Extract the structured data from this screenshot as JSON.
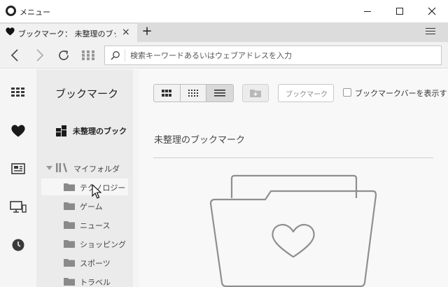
{
  "window": {
    "title": "メニュー"
  },
  "tab": {
    "label": "ブックマーク： 未整理のブックマーク",
    "close": "×",
    "new_tab": "+"
  },
  "address_bar": {
    "placeholder": "検索キーワードあるいはウェブアドレスを入力"
  },
  "sidebar_icons": [
    "speed-dial-icon",
    "heart-icon",
    "news-icon",
    "devices-icon",
    "history-icon"
  ],
  "panel": {
    "title": "ブックマーク",
    "unsorted_label": "未整理のブックマーク",
    "my_folder_label": "マイフォルダ",
    "folders": [
      "テクノロジー",
      "ゲーム",
      "ニュース",
      "ショッピング",
      "スポーツ",
      "トラベル"
    ]
  },
  "main": {
    "search_placeholder": "ブックマーク",
    "show_bar_label": "ブックマークバーを表示する",
    "show_bar_checked": false,
    "section_title": "未整理のブックマーク"
  },
  "colors": {
    "sidebar_bg": "#f5f5f5",
    "panel_bg": "#ebebeb",
    "main_bg": "#f8f8f8",
    "icon": "#3a3a3a"
  }
}
